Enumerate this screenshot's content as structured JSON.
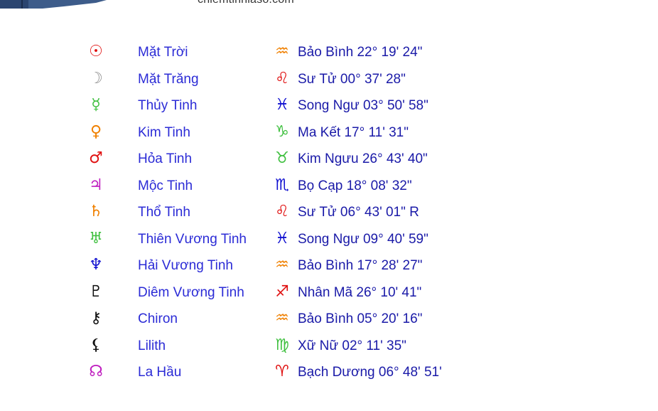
{
  "site": {
    "name": "chiemtinhlaso.com"
  },
  "colors": {
    "planet_name": "#2b2bd6",
    "position_text": "#1a1aa8",
    "banner": "#3d5c8a"
  },
  "planets": [
    {
      "icon": "sun-icon",
      "glyph": "☉",
      "glyph_color": "#e01010",
      "name": "Mặt Trời",
      "sign_icon": "aquarius-icon",
      "sign_glyph": "♒",
      "sign_color": "#f08000",
      "position": "Bảo Bình 22° 19' 24\""
    },
    {
      "icon": "moon-icon",
      "glyph": "☽",
      "glyph_color": "#909090",
      "name": "Mặt Trăng",
      "sign_icon": "leo-icon",
      "sign_glyph": "♌",
      "sign_color": "#e01010",
      "position": "Sư Tử 00° 37' 28\""
    },
    {
      "icon": "mercury-icon",
      "glyph": "☿",
      "glyph_color": "#40c040",
      "name": "Thủy Tinh",
      "sign_icon": "pisces-icon",
      "sign_glyph": "♓",
      "sign_color": "#1010d0",
      "position": "Song Ngư 03° 50' 58\""
    },
    {
      "icon": "venus-icon",
      "glyph": "♀",
      "glyph_color": "#f08000",
      "name": "Kim Tinh",
      "sign_icon": "capricorn-icon",
      "sign_glyph": "♑",
      "sign_color": "#40c040",
      "position": "Ma Kết 17° 11' 31\""
    },
    {
      "icon": "mars-icon",
      "glyph": "♂",
      "glyph_color": "#e01010",
      "name": "Hỏa Tinh",
      "sign_icon": "taurus-icon",
      "sign_glyph": "♉",
      "sign_color": "#40c040",
      "position": "Kim Ngưu 26° 43' 40\""
    },
    {
      "icon": "jupiter-icon",
      "glyph": "♃",
      "glyph_color": "#c020c0",
      "name": "Mộc Tinh",
      "sign_icon": "scorpio-icon",
      "sign_glyph": "♏",
      "sign_color": "#1010d0",
      "position": "Bọ Cạp 18° 08' 32\""
    },
    {
      "icon": "saturn-icon",
      "glyph": "♄",
      "glyph_color": "#f08000",
      "name": "Thổ Tinh",
      "sign_icon": "leo-icon",
      "sign_glyph": "♌",
      "sign_color": "#e01010",
      "position": "Sư Tử 06° 43' 01\" R"
    },
    {
      "icon": "uranus-icon",
      "glyph": "♅",
      "glyph_color": "#40c040",
      "name": "Thiên Vương Tinh",
      "sign_icon": "pisces-icon",
      "sign_glyph": "♓",
      "sign_color": "#1010d0",
      "position": "Song Ngư 09° 40' 59\""
    },
    {
      "icon": "neptune-icon",
      "glyph": "♆",
      "glyph_color": "#1010d0",
      "name": "Hải Vương Tinh",
      "sign_icon": "aquarius-icon",
      "sign_glyph": "♒",
      "sign_color": "#f08000",
      "position": "Bảo Bình 17° 28' 27\""
    },
    {
      "icon": "pluto-icon",
      "glyph": "♇",
      "glyph_color": "#111111",
      "name": "Diêm Vương Tinh",
      "sign_icon": "sagittarius-icon",
      "sign_glyph": "♐",
      "sign_color": "#e01010",
      "position": "Nhân Mã 26° 10' 41\""
    },
    {
      "icon": "chiron-icon",
      "glyph": "⚷",
      "glyph_color": "#111111",
      "name": "Chiron",
      "sign_icon": "aquarius-icon",
      "sign_glyph": "♒",
      "sign_color": "#f08000",
      "position": "Bảo Bình 05° 20' 16\""
    },
    {
      "icon": "lilith-icon",
      "glyph": "⚸",
      "glyph_color": "#111111",
      "name": "Lilith",
      "sign_icon": "virgo-icon",
      "sign_glyph": "♍",
      "sign_color": "#40c040",
      "position": "Xữ Nữ 02° 11' 35\""
    },
    {
      "icon": "north-node-icon",
      "glyph": "☊",
      "glyph_color": "#c020c0",
      "name": "La Hầu",
      "sign_icon": "aries-icon",
      "sign_glyph": "♈",
      "sign_color": "#e01010",
      "position": "Bạch Dương 06° 48' 51'"
    }
  ]
}
